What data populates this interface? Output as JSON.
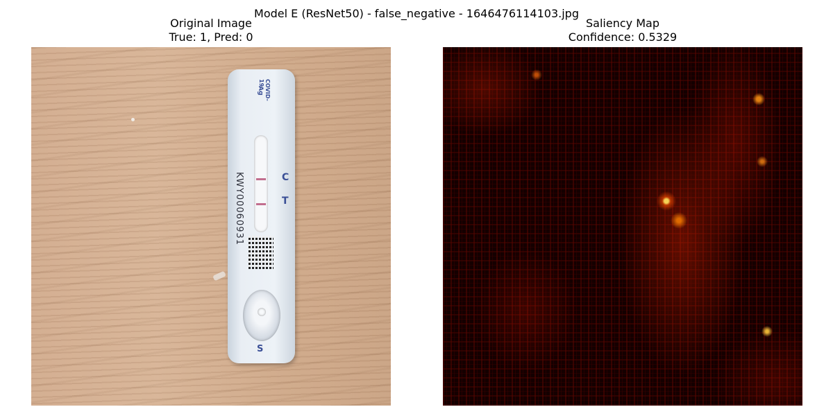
{
  "figure": {
    "suptitle": "Model E (ResNet50) - false_negative - 1646476114103.jpg"
  },
  "panels": [
    {
      "title_line1": "Original Image",
      "title_line2": "True: 1, Pred: 0"
    },
    {
      "title_line1": "Saliency Map",
      "title_line2": "Confidence: 0.5329"
    }
  ],
  "test_cassette": {
    "label_top": "COVID-19",
    "label_sub": "Ag",
    "marker_c": "C",
    "marker_t": "T",
    "serial": "KWY00060931",
    "marker_s": "S"
  },
  "colors": {
    "saliency_colormap": "hot",
    "cassette_print": "#3a4f96"
  }
}
